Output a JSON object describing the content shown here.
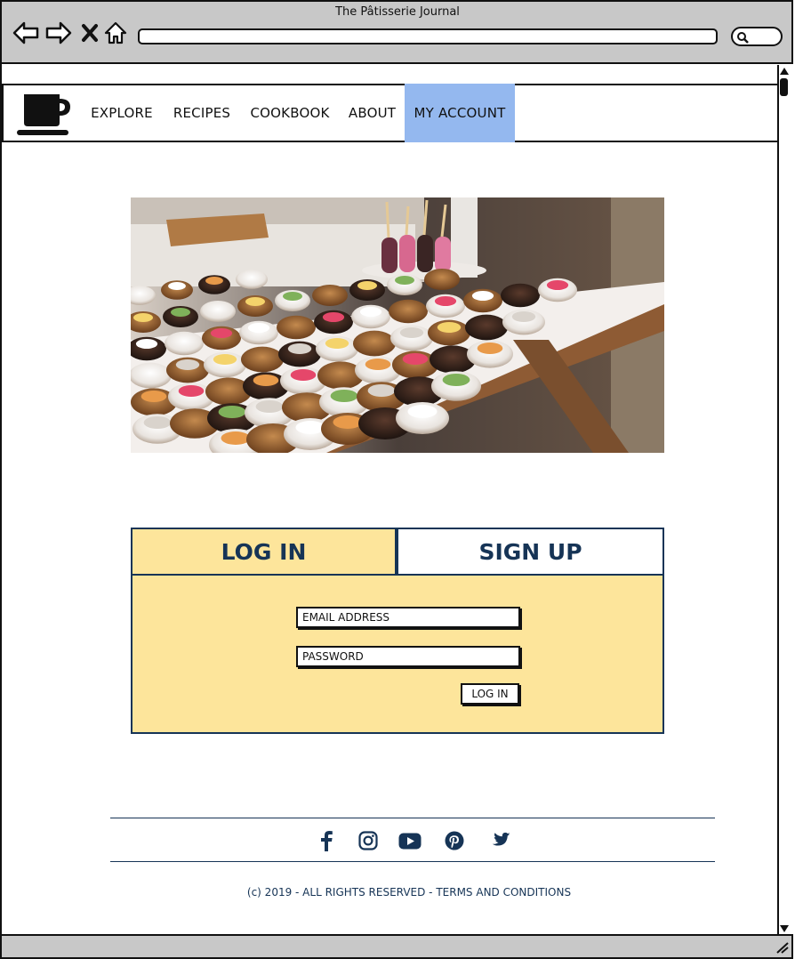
{
  "window": {
    "title": "The Pâtisserie Journal"
  },
  "toolbar": {
    "back_icon": "arrow-left-icon",
    "forward_icon": "arrow-right-icon",
    "close_icon": "close-icon",
    "home_icon": "home-icon",
    "search_icon": "search-icon"
  },
  "nav": {
    "logo_icon": "coffee-cup-icon",
    "items": [
      {
        "label": "EXPLORE",
        "active": false
      },
      {
        "label": "RECIPES",
        "active": false
      },
      {
        "label": "COOKBOOK",
        "active": false
      },
      {
        "label": "ABOUT",
        "active": false
      },
      {
        "label": "MY ACCOUNT",
        "active": true
      }
    ],
    "active_color": "#94b8ef"
  },
  "hero": {
    "subject": "pastry-display-photo"
  },
  "auth": {
    "tabs": {
      "login": "LOG IN",
      "signup": "SIGN UP"
    },
    "email_placeholder": "EMAIL ADDRESS",
    "password_placeholder": "PASSWORD",
    "submit_label": "LOG IN",
    "panel_color": "#fde59b",
    "accent_color": "#163456"
  },
  "footer": {
    "social_icons": [
      "facebook-icon",
      "instagram-icon",
      "youtube-icon",
      "pinterest-icon",
      "twitter-icon"
    ],
    "text": "(c) 2019 - ALL RIGHTS RESERVED - TERMS AND CONDITIONS"
  }
}
